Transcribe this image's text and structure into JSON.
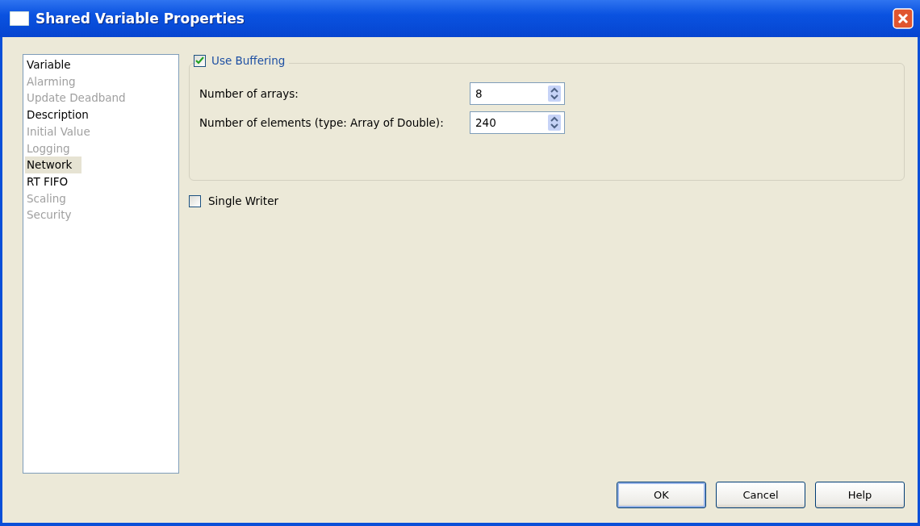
{
  "window": {
    "title": "Shared Variable Properties"
  },
  "categories": [
    {
      "label": "Variable",
      "disabled": false,
      "selected": false
    },
    {
      "label": "Alarming",
      "disabled": true,
      "selected": false
    },
    {
      "label": "Update Deadband",
      "disabled": true,
      "selected": false
    },
    {
      "label": "Description",
      "disabled": false,
      "selected": false
    },
    {
      "label": "Initial Value",
      "disabled": true,
      "selected": false
    },
    {
      "label": "Logging",
      "disabled": true,
      "selected": false
    },
    {
      "label": "Network",
      "disabled": false,
      "selected": true
    },
    {
      "label": "RT FIFO",
      "disabled": false,
      "selected": false
    },
    {
      "label": "Scaling",
      "disabled": true,
      "selected": false
    },
    {
      "label": "Security",
      "disabled": true,
      "selected": false
    }
  ],
  "buffering": {
    "label": "Use Buffering",
    "checked": true,
    "fields": [
      {
        "label": "Number of arrays:",
        "value": "8"
      },
      {
        "label": "Number of elements (type: Array of Double):",
        "value": "240"
      }
    ]
  },
  "single_writer": {
    "label": "Single Writer",
    "checked": false
  },
  "buttons": [
    {
      "label": "OK",
      "default": true
    },
    {
      "label": "Cancel",
      "default": false
    },
    {
      "label": "Help",
      "default": false
    }
  ]
}
